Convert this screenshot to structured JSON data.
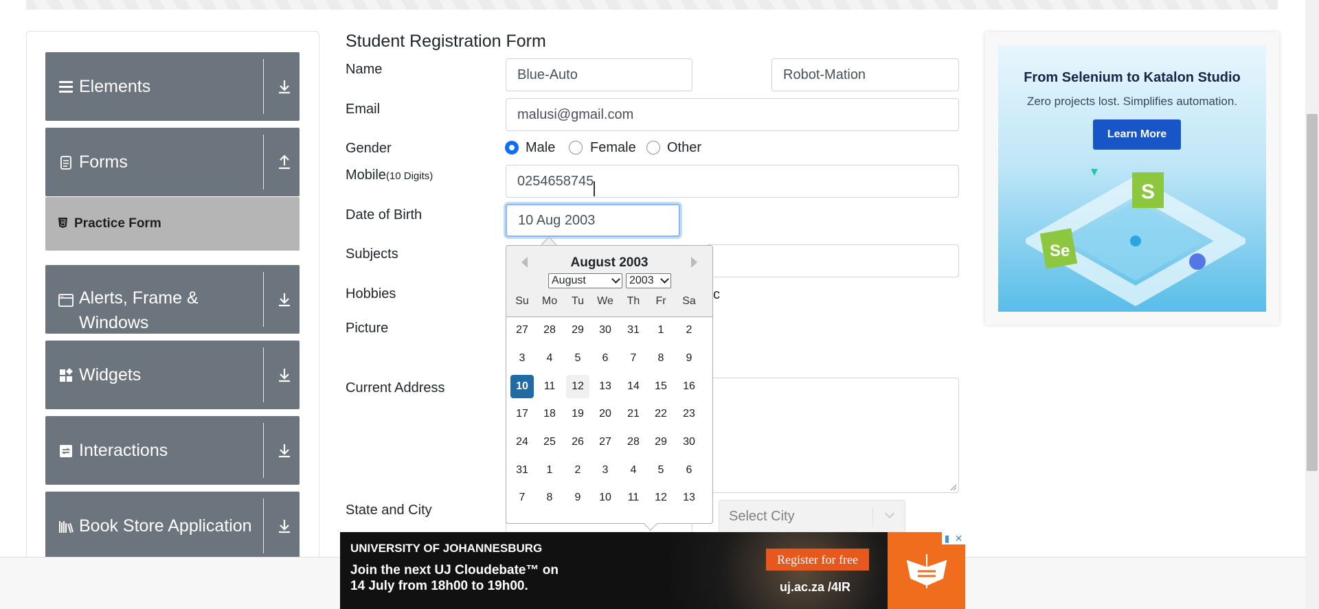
{
  "sidebar": {
    "groups": [
      {
        "label": "Elements",
        "icon": "list-icon",
        "arrow": "download-arrow-icon"
      },
      {
        "label": "Forms",
        "icon": "document-icon",
        "arrow": "upload-arrow-icon"
      },
      {
        "label": "Alerts, Frame &\nWindows",
        "icon": "window-icon",
        "arrow": "download-arrow-icon"
      },
      {
        "label": "Widgets",
        "icon": "widgets-icon",
        "arrow": "download-arrow-icon"
      },
      {
        "label": "Interactions",
        "icon": "interactions-icon",
        "arrow": "download-arrow-icon"
      },
      {
        "label": "Book Store Application",
        "icon": "books-icon",
        "arrow": "download-arrow-icon"
      }
    ],
    "active_item": "Practice Form"
  },
  "form": {
    "title": "Student Registration Form",
    "labels": {
      "name": "Name",
      "email": "Email",
      "gender": "Gender",
      "mobile": "Mobile",
      "mobile_hint": "(10 Digits)",
      "dob": "Date of Birth",
      "subjects": "Subjects",
      "hobbies": "Hobbies",
      "picture": "Picture",
      "address": "Current Address",
      "state_city": "State and City"
    },
    "first_name": "Blue-Auto",
    "last_name": "Robot-Mation",
    "email": "malusi@gmail.com",
    "gender_options": [
      "Male",
      "Female",
      "Other"
    ],
    "gender_selected": "Male",
    "mobile": "0254658745",
    "dob": "10 Aug 2003",
    "hobby_fragment": "c",
    "city_placeholder": "Select City"
  },
  "datepicker": {
    "title": "August 2003",
    "month_select": "August",
    "year_select": "2003",
    "weekdays": [
      "Su",
      "Mo",
      "Tu",
      "We",
      "Th",
      "Fr",
      "Sa"
    ],
    "weeks": [
      [
        "27",
        "28",
        "29",
        "30",
        "31",
        "1",
        "2"
      ],
      [
        "3",
        "4",
        "5",
        "6",
        "7",
        "8",
        "9"
      ],
      [
        "10",
        "11",
        "12",
        "13",
        "14",
        "15",
        "16"
      ],
      [
        "17",
        "18",
        "19",
        "20",
        "21",
        "22",
        "23"
      ],
      [
        "24",
        "25",
        "26",
        "27",
        "28",
        "29",
        "30"
      ],
      [
        "31",
        "1",
        "2",
        "3",
        "4",
        "5",
        "6"
      ],
      [
        "7",
        "8",
        "9",
        "10",
        "11",
        "12",
        "13"
      ]
    ],
    "selected_day": "10",
    "keyboard_day": "12"
  },
  "ad_right": {
    "headline": "From Selenium to Katalon Studio",
    "subline": "Zero projects lost. Simplifies automation.",
    "button": "Learn More"
  },
  "ad_bottom": {
    "org": "UNIVERSITY OF JOHANNESBURG",
    "message": "Join the next UJ Cloudebate™ on\n14 July from 18h00 to 19h00.",
    "button": "Register for free",
    "url": "uj.ac.za /4IR"
  },
  "colors": {
    "sidebar_group": "#6c757d",
    "active_item": "#b5b5b5",
    "radio_checked": "#0d6efd",
    "selected_day": "#216ba5",
    "ad_button": "#1856c7",
    "ad_orange": "#f06d1e"
  }
}
